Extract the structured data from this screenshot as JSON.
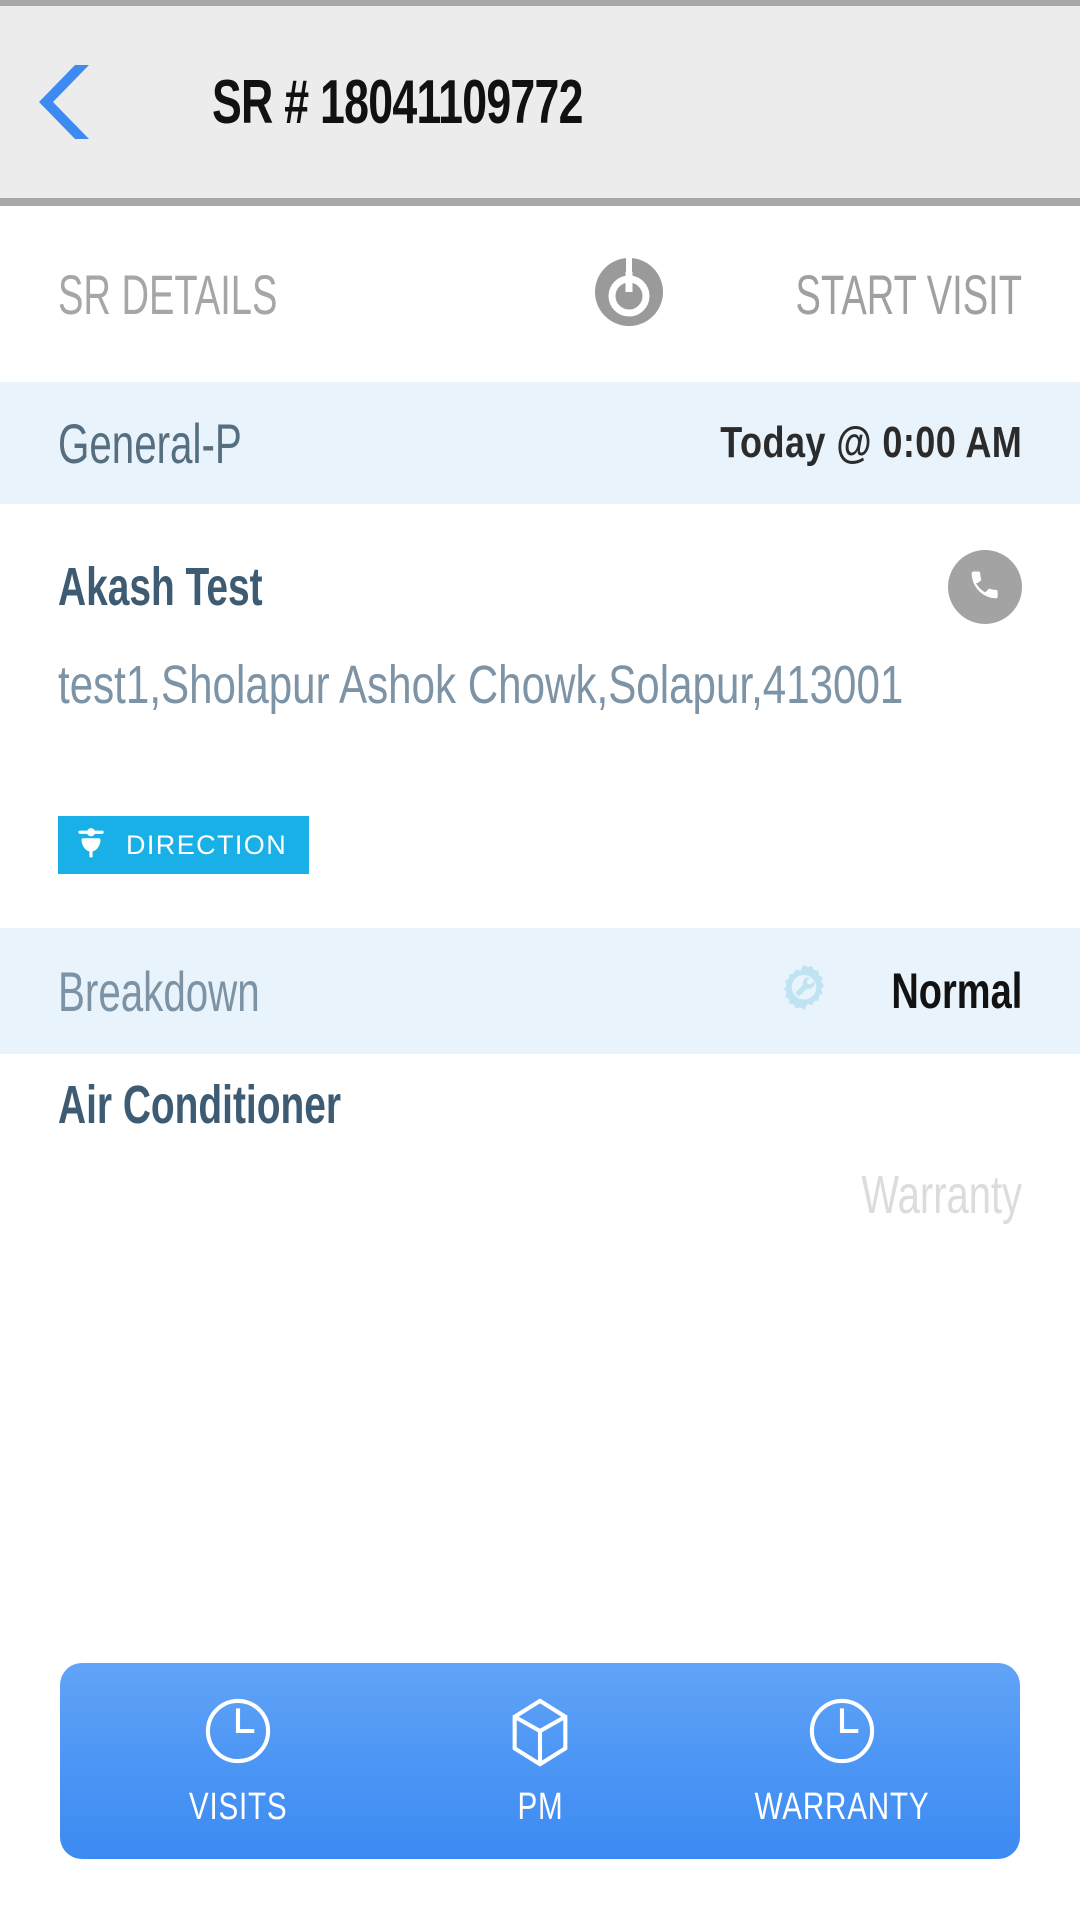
{
  "appbar": {
    "back_icon": "chevron-left-icon",
    "title": "SR # 18041109772",
    "accent_color": "#3d8bf2",
    "background_color": "#ececec"
  },
  "section_header": {
    "left_label": "SR DETAILS",
    "start_visit_label": "START VISIT",
    "start_visit_icon": "power-visit-icon"
  },
  "service_row": {
    "type_label": "General-P",
    "schedule": "Today  @ 0:00 AM",
    "band_color": "#e9f3fb"
  },
  "customer": {
    "name": "Akash Test",
    "address": "test1,Sholapur Ashok Chowk,Solapur,413001",
    "call_icon": "phone-icon",
    "direction_label": "DIRECTION",
    "direction_icon": "scooter-icon",
    "direction_color": "#19b0e8"
  },
  "problem_row": {
    "label": "Breakdown",
    "priority": "Normal",
    "priority_icon": "gear-wrench-icon"
  },
  "asset": {
    "name": "Air Conditioner",
    "coverage": "Warranty"
  },
  "tabbar": {
    "background_color": "#4e97f5",
    "items": [
      {
        "label": "VISITS",
        "icon": "clock-icon"
      },
      {
        "label": "PM",
        "icon": "box-3d-icon"
      },
      {
        "label": "WARRANTY",
        "icon": "clock-icon"
      }
    ]
  }
}
